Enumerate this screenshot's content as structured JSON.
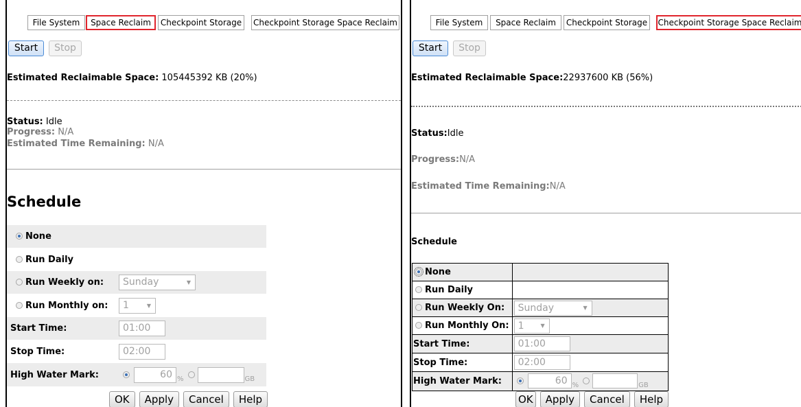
{
  "left": {
    "tabs": [
      "File System",
      "Space Reclaim",
      "Checkpoint Storage",
      "Checkpoint Storage Space Reclaim"
    ],
    "start_label": "Start",
    "stop_label": "Stop",
    "est_label": "Estimated Reclaimable Space:",
    "est_value": " 105445392 KB (20%)",
    "status_label": "Status:",
    "status_value": " Idle",
    "progress_label": "Progress:",
    "progress_value": " N/A",
    "time_label": "Estimated Time Remaining:",
    "time_value": " N/A",
    "schedule_title": "Schedule",
    "none_label": "None",
    "daily_label": "Run Daily",
    "weekly_label": "Run Weekly on:",
    "weekly_value": "Sunday",
    "monthly_label": "Run Monthly on:",
    "monthly_value": "1",
    "start_time_label": "Start Time:",
    "start_time_value": "01:00",
    "stop_time_label": "Stop Time:",
    "stop_time_value": "02:00",
    "hwm_label": "High Water Mark:",
    "hwm_value": "60",
    "pct_unit": "%",
    "gb_unit": "GB",
    "ok_label": "OK",
    "apply_label": "Apply",
    "cancel_label": "Cancel",
    "help_label": "Help"
  },
  "right": {
    "tabs": [
      "File System",
      "Space Reclaim",
      "Checkpoint Storage",
      "Checkpoint Storage Space Reclaim"
    ],
    "start_label": "Start",
    "stop_label": "Stop",
    "est_label": "Estimated Reclaimable Space:",
    "est_value": "22937600 KB (56%)",
    "status_label": "Status:",
    "status_value": "Idle",
    "progress_label": "Progress:",
    "progress_value": "N/A",
    "time_label": "Estimated Time Remaining:",
    "time_value": "N/A",
    "schedule_title": "Schedule",
    "none_label": "None",
    "daily_label": "Run Daily",
    "weekly_label": "Run Weekly On:",
    "weekly_value": "Sunday",
    "monthly_label": "Run Monthly On:",
    "monthly_value": "1",
    "start_time_label": "Start Time:",
    "start_time_value": "01:00",
    "stop_time_label": "Stop Time:",
    "stop_time_value": "02:00",
    "hwm_label": "High Water Mark:",
    "hwm_value": "60",
    "pct_unit": "%",
    "gb_unit": "GB",
    "ok_label": "OK",
    "apply_label": "Apply",
    "cancel_label": "Cancel",
    "help_label": "Help"
  },
  "colors": {
    "selected_tab_border": "#e0242c",
    "primary_button": "#4a8bd6",
    "row_shade": "#ececec"
  }
}
